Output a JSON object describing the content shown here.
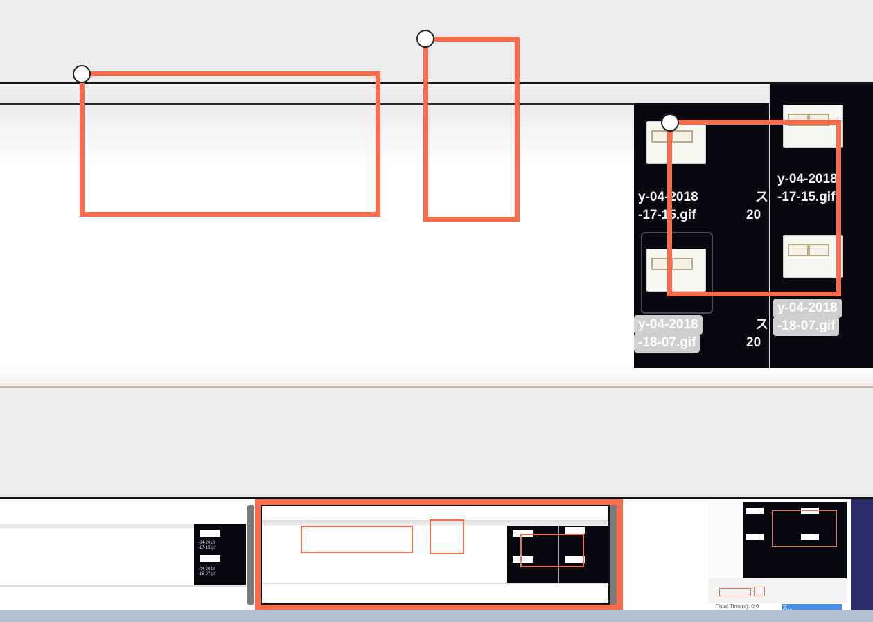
{
  "preview": {
    "files": [
      {
        "line1": "y-04-2018",
        "line2": "-17-15.gif"
      },
      {
        "line1": "y-04-2018",
        "line2": "-18-07.gif"
      },
      {
        "line1": "y-04-2018",
        "line2": "-17-15.gif"
      },
      {
        "line1": "y-04-2018",
        "line2": "-18-07.gif"
      }
    ],
    "side_labels": [
      "ス",
      "20",
      "ス",
      "20"
    ]
  },
  "filmstrip": {
    "frame1": {
      "label1": "-04-2018",
      "label2": "-17-15.gif",
      "label3": "-04-2018",
      "label4": "-18-07.gif"
    },
    "frame3": {
      "status": "Total Time(s): 0.6",
      "button": "ス..."
    }
  },
  "colors": {
    "annotation": "#fb6a4a",
    "dark_panel": "#070810",
    "background": "#ececec",
    "status_bar": "#b3c2d3"
  }
}
